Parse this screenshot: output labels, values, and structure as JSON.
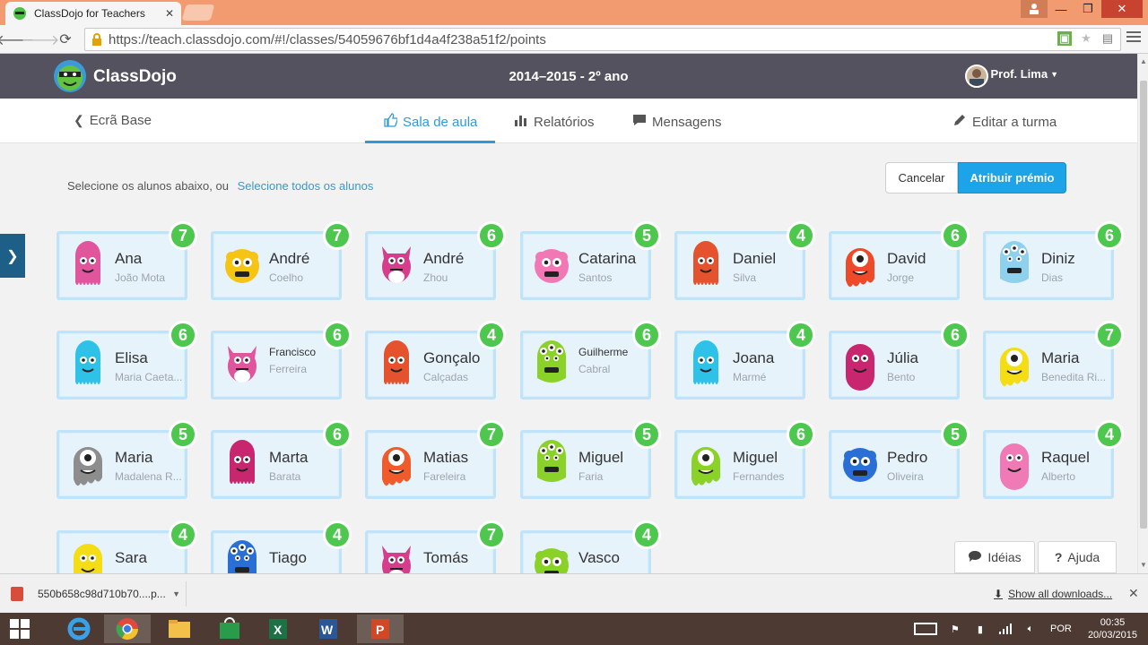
{
  "browser": {
    "tab_title": "ClassDojo for Teachers",
    "tab_close": "✕",
    "url": "https://teach.classdojo.com/#!/classes/54059676bf1d4a4f238a51f2/points"
  },
  "header": {
    "brand": "ClassDojo",
    "class_name": "2014–2015 - 2º ano",
    "teacher": "Prof. Lima"
  },
  "nav": {
    "home": "Ecrã Base",
    "classroom": "Sala de aula",
    "reports": "Relatórios",
    "messages": "Mensagens",
    "edit_class": "Editar a turma"
  },
  "selection": {
    "prompt": "Selecione os alunos abaixo, ou",
    "select_all": "Selecione todos os alunos"
  },
  "actions": {
    "cancel": "Cancelar",
    "award": "Atribuir prémio"
  },
  "students": [
    {
      "first": "Ana",
      "last": "João Mota",
      "points": "7",
      "color": "#e0559c",
      "shape": "squid"
    },
    {
      "first": "André",
      "last": "Coelho",
      "points": "7",
      "color": "#f5c415",
      "shape": "fuzzy"
    },
    {
      "first": "André",
      "last": "Zhou",
      "points": "6",
      "color": "#d63d8a",
      "shape": "horned"
    },
    {
      "first": "Catarina",
      "last": "Santos",
      "points": "5",
      "color": "#f178b4",
      "shape": "fuzzy"
    },
    {
      "first": "Daniel",
      "last": "Silva",
      "points": "4",
      "color": "#e4532e",
      "shape": "squid"
    },
    {
      "first": "David",
      "last": "Jorge",
      "points": "6",
      "color": "#ee4a2a",
      "shape": "cyclops"
    },
    {
      "first": "Diniz",
      "last": "Dias",
      "points": "6",
      "color": "#8fd1ec",
      "shape": "multi"
    },
    {
      "first": "Elisa",
      "last": "Maria Caeta...",
      "points": "6",
      "color": "#2fc2e8",
      "shape": "squid"
    },
    {
      "first": "Francisco",
      "last": "Ferreira",
      "points": "6",
      "color": "#e0559c",
      "shape": "horned"
    },
    {
      "first": "Gonçalo",
      "last": "Calçadas",
      "points": "4",
      "color": "#e4532e",
      "shape": "squid"
    },
    {
      "first": "Guilherme",
      "last": "Cabral",
      "points": "6",
      "color": "#8ad128",
      "shape": "multi"
    },
    {
      "first": "Joana",
      "last": "Marmé",
      "points": "4",
      "color": "#2fc2e8",
      "shape": "squid"
    },
    {
      "first": "Júlia",
      "last": "Bento",
      "points": "6",
      "color": "#c8276f",
      "shape": "blob"
    },
    {
      "first": "Maria",
      "last": "Benedita Ri...",
      "points": "7",
      "color": "#f5dd15",
      "shape": "cyclops"
    },
    {
      "first": "Maria",
      "last": "Madalena R...",
      "points": "5",
      "color": "#8d8d8d",
      "shape": "cyclops"
    },
    {
      "first": "Marta",
      "last": "Barata",
      "points": "6",
      "color": "#c8276f",
      "shape": "squid"
    },
    {
      "first": "Matias",
      "last": "Fareleira",
      "points": "7",
      "color": "#ef5b2a",
      "shape": "cyclops"
    },
    {
      "first": "Miguel",
      "last": "Faria",
      "points": "5",
      "color": "#8ad128",
      "shape": "multi"
    },
    {
      "first": "Miguel",
      "last": "Fernandes",
      "points": "6",
      "color": "#8ad128",
      "shape": "cyclops"
    },
    {
      "first": "Pedro",
      "last": "Oliveira",
      "points": "5",
      "color": "#2a6fd6",
      "shape": "fuzzy"
    },
    {
      "first": "Raquel",
      "last": "Alberto",
      "points": "4",
      "color": "#f07ab5",
      "shape": "blob"
    },
    {
      "first": "Sara",
      "last": "",
      "points": "4",
      "color": "#f5dd15",
      "shape": "blob"
    },
    {
      "first": "Tiago",
      "last": "",
      "points": "4",
      "color": "#2a6fd6",
      "shape": "multi"
    },
    {
      "first": "Tomás",
      "last": "",
      "points": "7",
      "color": "#d63d8a",
      "shape": "horned"
    },
    {
      "first": "Vasco",
      "last": "",
      "points": "4",
      "color": "#8ad128",
      "shape": "fuzzy"
    }
  ],
  "help": {
    "ideas": "Idéias",
    "help": "Ajuda"
  },
  "downloads": {
    "file": "550b658c98d710b70....p...",
    "show_all": "Show all downloads...",
    "close": "✕"
  },
  "taskbar": {
    "language": "POR",
    "time": "00:35",
    "date": "20/03/2015"
  }
}
